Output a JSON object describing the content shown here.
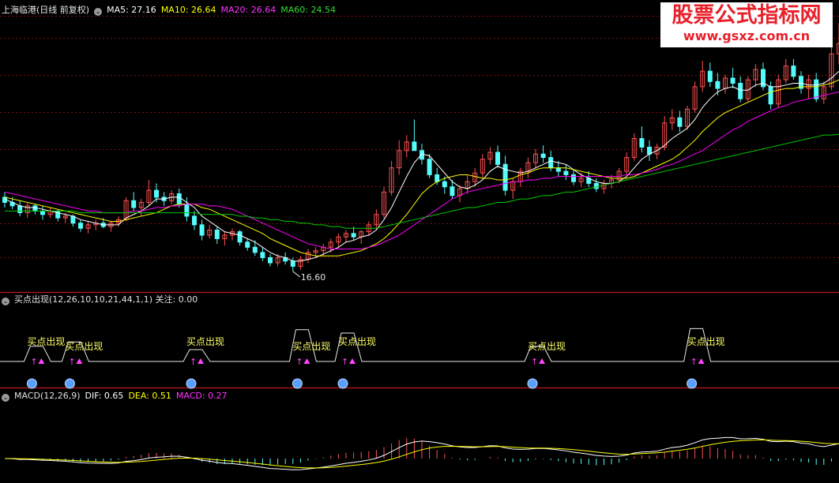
{
  "kline_panel": {
    "stock_name": "上海临港(日线 前复权)",
    "ma5": "MA5: 27.16",
    "ma10": "MA10: 26.64",
    "ma20": "MA20: 26.64",
    "ma60": "MA60: 24.54",
    "low_marker": "16.60"
  },
  "signal_panel": {
    "header": "买点出现(12,26,10,10,21,44,1,1) 关注: 0.00",
    "signal_label": "买点出现"
  },
  "macd_panel": {
    "name": "MACD(12,26,9)",
    "dif": "DIF: 0.65",
    "dea": "DEA: 0.51",
    "macd": "MACD: 0.27"
  },
  "watermark": {
    "title": "股票公式指标网",
    "url": "www.gsxz.com.cn"
  },
  "colors": {
    "background": "#000000",
    "up_candle": "#ff5050",
    "down_candle": "#54fcfc",
    "ma5": "#ffffff",
    "ma10": "#ffff00",
    "ma20": "#ff00ff",
    "ma60": "#00cc00",
    "grid": "#7a1010",
    "divider": "#c01818",
    "signal_text": "#ffff66",
    "signal_arrow": "#ff44ff"
  },
  "chart_data": {
    "type": "candlestick",
    "price_range": [
      15.5,
      31.5
    ],
    "candles_ohlc": [
      [
        20.9,
        21.2,
        20.3,
        20.6
      ],
      [
        20.6,
        20.9,
        20.2,
        20.4
      ],
      [
        20.4,
        20.7,
        19.8,
        20.0
      ],
      [
        20.0,
        20.6,
        19.7,
        20.4
      ],
      [
        20.4,
        20.5,
        19.9,
        20.1
      ],
      [
        20.1,
        20.4,
        19.6,
        19.9
      ],
      [
        19.9,
        20.3,
        19.7,
        20.1
      ],
      [
        20.1,
        20.2,
        19.5,
        19.7
      ],
      [
        19.7,
        20.0,
        19.4,
        19.8
      ],
      [
        19.8,
        19.9,
        19.2,
        19.4
      ],
      [
        19.4,
        19.6,
        18.9,
        19.1
      ],
      [
        19.1,
        19.5,
        18.8,
        19.3
      ],
      [
        19.3,
        19.6,
        19.0,
        19.4
      ],
      [
        19.4,
        19.7,
        19.1,
        19.2
      ],
      [
        19.2,
        19.5,
        18.9,
        19.4
      ],
      [
        19.4,
        19.8,
        19.2,
        19.6
      ],
      [
        19.6,
        20.9,
        19.5,
        20.7
      ],
      [
        20.7,
        21.2,
        20.1,
        20.3
      ],
      [
        20.3,
        20.8,
        19.8,
        20.6
      ],
      [
        20.6,
        21.9,
        20.4,
        21.3
      ],
      [
        21.3,
        21.7,
        20.6,
        20.9
      ],
      [
        20.9,
        21.2,
        20.4,
        20.7
      ],
      [
        20.7,
        21.3,
        20.5,
        21.1
      ],
      [
        21.1,
        21.4,
        20.3,
        20.5
      ],
      [
        20.5,
        20.9,
        19.5,
        19.8
      ],
      [
        19.8,
        20.1,
        19.0,
        19.3
      ],
      [
        19.3,
        19.6,
        18.4,
        18.7
      ],
      [
        18.7,
        19.3,
        18.5,
        19.0
      ],
      [
        19.0,
        19.2,
        18.2,
        18.5
      ],
      [
        18.5,
        18.9,
        18.1,
        18.7
      ],
      [
        18.7,
        19.1,
        18.4,
        18.9
      ],
      [
        18.9,
        19.0,
        18.1,
        18.3
      ],
      [
        18.3,
        18.5,
        17.8,
        18.0
      ],
      [
        18.0,
        18.4,
        17.5,
        17.7
      ],
      [
        17.7,
        18.0,
        17.2,
        17.4
      ],
      [
        17.4,
        17.6,
        16.9,
        17.1
      ],
      [
        17.1,
        17.6,
        16.9,
        17.4
      ],
      [
        17.4,
        17.7,
        17.0,
        17.2
      ],
      [
        17.2,
        17.4,
        16.6,
        16.9
      ],
      [
        16.9,
        17.5,
        16.7,
        17.3
      ],
      [
        17.3,
        17.9,
        17.1,
        17.7
      ],
      [
        17.7,
        18.0,
        17.4,
        17.8
      ],
      [
        17.8,
        18.2,
        17.5,
        18.0
      ],
      [
        18.0,
        18.5,
        17.7,
        18.3
      ],
      [
        18.3,
        18.8,
        18.0,
        18.6
      ],
      [
        18.6,
        19.0,
        18.3,
        18.8
      ],
      [
        18.8,
        19.2,
        18.4,
        18.6
      ],
      [
        18.6,
        19.0,
        18.2,
        18.9
      ],
      [
        18.9,
        19.5,
        18.7,
        19.3
      ],
      [
        19.3,
        20.2,
        19.0,
        19.9
      ],
      [
        19.9,
        21.5,
        19.7,
        21.2
      ],
      [
        21.2,
        23.0,
        21.0,
        22.6
      ],
      [
        22.6,
        24.2,
        22.2,
        23.6
      ],
      [
        23.6,
        24.5,
        23.2,
        24.1
      ],
      [
        24.1,
        25.4,
        23.7,
        23.6
      ],
      [
        23.6,
        24.0,
        22.8,
        23.1
      ],
      [
        23.1,
        23.4,
        22.0,
        22.2
      ],
      [
        22.2,
        22.6,
        21.6,
        21.8
      ],
      [
        21.8,
        22.1,
        21.1,
        21.5
      ],
      [
        21.5,
        21.9,
        20.8,
        21.0
      ],
      [
        21.0,
        21.6,
        20.6,
        21.4
      ],
      [
        21.4,
        22.2,
        21.1,
        21.8
      ],
      [
        21.8,
        22.6,
        21.5,
        22.3
      ],
      [
        22.3,
        23.4,
        22.0,
        23.1
      ],
      [
        23.1,
        23.8,
        22.8,
        23.5
      ],
      [
        23.5,
        23.9,
        22.6,
        22.8
      ],
      [
        22.8,
        23.3,
        21.0,
        21.3
      ],
      [
        21.3,
        22.0,
        20.8,
        21.8
      ],
      [
        21.8,
        22.6,
        21.5,
        22.4
      ],
      [
        22.4,
        23.2,
        22.0,
        22.9
      ],
      [
        22.9,
        23.7,
        22.6,
        23.4
      ],
      [
        23.4,
        23.9,
        22.9,
        23.2
      ],
      [
        23.2,
        23.6,
        22.4,
        22.6
      ],
      [
        22.6,
        23.0,
        22.1,
        22.4
      ],
      [
        22.4,
        22.8,
        21.9,
        22.2
      ],
      [
        22.2,
        22.5,
        21.6,
        21.8
      ],
      [
        21.8,
        22.3,
        21.5,
        22.0
      ],
      [
        22.0,
        22.4,
        21.5,
        21.7
      ],
      [
        21.7,
        22.0,
        21.2,
        21.4
      ],
      [
        21.4,
        21.9,
        21.1,
        21.7
      ],
      [
        21.7,
        22.2,
        21.4,
        21.9
      ],
      [
        21.9,
        22.6,
        21.7,
        22.4
      ],
      [
        22.4,
        23.5,
        22.2,
        23.2
      ],
      [
        23.2,
        24.6,
        23.0,
        24.3
      ],
      [
        24.3,
        25.0,
        23.5,
        23.8
      ],
      [
        23.8,
        24.2,
        23.0,
        23.4
      ],
      [
        23.4,
        24.0,
        23.1,
        23.8
      ],
      [
        23.8,
        25.6,
        23.6,
        25.2
      ],
      [
        25.2,
        26.0,
        24.8,
        25.5
      ],
      [
        25.5,
        25.9,
        24.7,
        25.0
      ],
      [
        25.0,
        26.2,
        24.8,
        26.0
      ],
      [
        26.0,
        27.6,
        25.8,
        27.3
      ],
      [
        27.3,
        28.8,
        27.0,
        28.2
      ],
      [
        28.2,
        28.7,
        27.3,
        27.6
      ],
      [
        27.6,
        28.1,
        26.8,
        27.2
      ],
      [
        27.2,
        28.0,
        26.9,
        27.8
      ],
      [
        27.8,
        28.4,
        27.2,
        27.5
      ],
      [
        27.5,
        27.9,
        26.4,
        26.6
      ],
      [
        26.6,
        27.9,
        26.4,
        27.7
      ],
      [
        27.7,
        28.6,
        27.3,
        28.3
      ],
      [
        28.3,
        28.7,
        27.1,
        27.3
      ],
      [
        27.3,
        27.6,
        26.0,
        26.3
      ],
      [
        26.3,
        28.0,
        26.1,
        27.7
      ],
      [
        27.7,
        28.9,
        27.5,
        28.5
      ],
      [
        28.5,
        28.9,
        27.7,
        27.9
      ],
      [
        27.9,
        28.2,
        26.9,
        27.2
      ],
      [
        27.2,
        28.0,
        26.6,
        27.7
      ],
      [
        27.7,
        28.1,
        26.4,
        26.6
      ],
      [
        26.6,
        27.6,
        26.3,
        27.3
      ],
      [
        27.3,
        29.6,
        27.1,
        29.2
      ],
      [
        29.2,
        31.0,
        28.6,
        29.8
      ]
    ],
    "ma_series": [
      {
        "name": "MA5",
        "values": [
          20.8,
          20.6,
          20.4,
          20.3,
          20.3,
          20.2,
          20.1,
          20.0,
          19.9,
          19.8,
          19.6,
          19.5,
          19.4,
          19.3,
          19.3,
          19.3,
          19.7,
          19.9,
          20.1,
          20.4,
          20.8,
          20.8,
          20.9,
          20.9,
          20.6,
          20.3,
          19.8,
          19.5,
          19.2,
          18.9,
          18.8,
          18.7,
          18.5,
          18.3,
          18.0,
          17.7,
          17.5,
          17.4,
          17.2,
          17.2,
          17.3,
          17.4,
          17.6,
          17.8,
          18.0,
          18.3,
          18.4,
          18.6,
          18.7,
          19.0,
          19.6,
          20.3,
          21.2,
          22.1,
          22.9,
          23.4,
          23.3,
          22.8,
          22.3,
          21.8,
          21.5,
          21.4,
          21.6,
          21.9,
          22.4,
          22.7,
          22.5,
          22.4,
          22.3,
          22.4,
          22.6,
          22.8,
          23.0,
          22.9,
          22.8,
          22.5,
          22.2,
          22.0,
          21.8,
          21.7,
          21.7,
          21.8,
          22.1,
          22.6,
          23.1,
          23.4,
          23.6,
          23.9,
          24.3,
          24.6,
          24.9,
          25.4,
          26.1,
          26.6,
          27.0,
          27.2,
          27.3,
          27.1,
          27.1,
          27.4,
          27.5,
          27.3,
          27.3,
          27.4,
          27.5,
          27.5,
          27.4,
          27.4,
          27.5,
          27.8,
          28.2
        ]
      },
      {
        "name": "MA10",
        "values": [
          20.9,
          20.8,
          20.7,
          20.6,
          20.5,
          20.4,
          20.3,
          20.2,
          20.1,
          20.0,
          19.9,
          19.8,
          19.7,
          19.6,
          19.5,
          19.5,
          19.6,
          19.7,
          19.8,
          19.9,
          20.0,
          20.2,
          20.4,
          20.5,
          20.5,
          20.5,
          20.3,
          20.2,
          20.0,
          19.8,
          19.6,
          19.4,
          19.2,
          19.0,
          18.8,
          18.5,
          18.3,
          18.1,
          17.9,
          17.7,
          17.6,
          17.5,
          17.5,
          17.5,
          17.5,
          17.6,
          17.7,
          17.8,
          18.0,
          18.2,
          18.5,
          18.9,
          19.4,
          19.9,
          20.5,
          21.1,
          21.5,
          21.8,
          22.0,
          22.1,
          22.2,
          22.2,
          22.1,
          22.0,
          22.0,
          21.9,
          21.9,
          22.0,
          22.2,
          22.3,
          22.5,
          22.6,
          22.6,
          22.6,
          22.6,
          22.5,
          22.4,
          22.3,
          22.2,
          22.1,
          22.0,
          22.0,
          22.0,
          22.1,
          22.3,
          22.5,
          22.7,
          22.9,
          23.1,
          23.4,
          23.8,
          24.2,
          24.7,
          25.1,
          25.5,
          25.8,
          26.0,
          26.2,
          26.4,
          26.6,
          26.8,
          27.0,
          27.1,
          27.2,
          27.2,
          27.3,
          27.3,
          27.3,
          27.4,
          27.5,
          27.7
        ]
      },
      {
        "name": "MA20",
        "values": [
          21.2,
          21.1,
          21.0,
          20.9,
          20.8,
          20.7,
          20.6,
          20.5,
          20.4,
          20.3,
          20.2,
          20.1,
          20.1,
          20.0,
          20.0,
          20.0,
          20.0,
          20.1,
          20.1,
          20.2,
          20.3,
          20.3,
          20.4,
          20.4,
          20.5,
          20.5,
          20.5,
          20.4,
          20.4,
          20.3,
          20.2,
          20.0,
          19.8,
          19.6,
          19.4,
          19.2,
          19.0,
          18.8,
          18.6,
          18.4,
          18.2,
          18.1,
          18.0,
          17.9,
          17.9,
          17.9,
          17.9,
          17.9,
          18.0,
          18.1,
          18.3,
          18.5,
          18.7,
          19.0,
          19.3,
          19.6,
          19.9,
          20.2,
          20.5,
          20.8,
          21.0,
          21.2,
          21.3,
          21.4,
          21.5,
          21.6,
          21.7,
          21.8,
          21.8,
          21.9,
          21.9,
          22.0,
          22.0,
          22.1,
          22.1,
          22.1,
          22.1,
          22.1,
          22.1,
          22.1,
          22.1,
          22.1,
          22.2,
          22.2,
          22.3,
          22.4,
          22.5,
          22.7,
          22.8,
          23.0,
          23.2,
          23.4,
          23.6,
          23.9,
          24.2,
          24.5,
          24.8,
          25.0,
          25.3,
          25.5,
          25.7,
          25.9,
          26.1,
          26.2,
          26.4,
          26.5,
          26.6,
          26.7,
          26.8,
          26.9,
          27.0
        ]
      },
      {
        "name": "MA60",
        "values": [
          20.1,
          20.1,
          20.1,
          20.1,
          20.1,
          20.1,
          20.1,
          20.1,
          20.1,
          20.1,
          20.0,
          20.0,
          20.0,
          20.0,
          20.0,
          20.0,
          20.0,
          20.0,
          20.0,
          20.0,
          20.0,
          20.0,
          20.0,
          20.0,
          20.0,
          20.0,
          19.9,
          19.9,
          19.9,
          19.9,
          19.9,
          19.8,
          19.8,
          19.7,
          19.7,
          19.6,
          19.6,
          19.5,
          19.5,
          19.4,
          19.4,
          19.3,
          19.3,
          19.2,
          19.2,
          19.1,
          19.1,
          19.1,
          19.1,
          19.1,
          19.2,
          19.3,
          19.4,
          19.5,
          19.6,
          19.7,
          19.8,
          19.9,
          20.0,
          20.1,
          20.2,
          20.3,
          20.3,
          20.4,
          20.5,
          20.6,
          20.6,
          20.7,
          20.8,
          20.8,
          20.9,
          21.0,
          21.0,
          21.1,
          21.2,
          21.2,
          21.3,
          21.4,
          21.5,
          21.6,
          21.7,
          21.8,
          21.9,
          22.0,
          22.1,
          22.2,
          22.3,
          22.4,
          22.5,
          22.6,
          22.7,
          22.8,
          22.9,
          23.0,
          23.1,
          23.2,
          23.3,
          23.4,
          23.5,
          23.6,
          23.7,
          23.8,
          23.9,
          24.0,
          24.1,
          24.2,
          24.3,
          24.4,
          24.5,
          24.5,
          24.54
        ]
      }
    ],
    "signal_days": [
      4,
      9,
      25,
      39,
      45,
      70,
      91
    ]
  }
}
